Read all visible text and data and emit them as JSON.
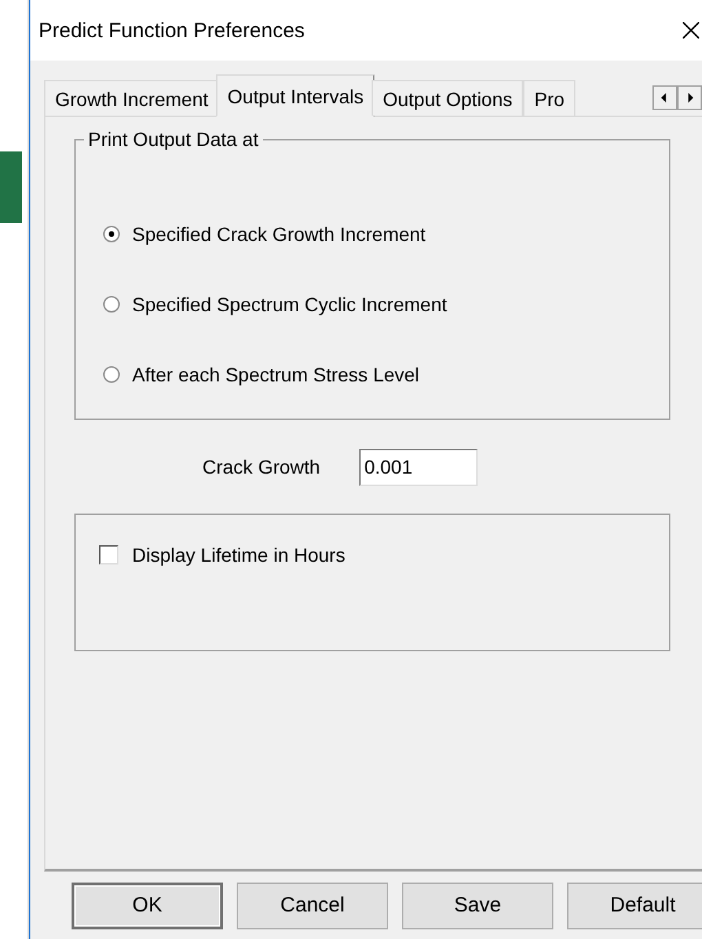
{
  "window": {
    "title": "Predict Function Preferences"
  },
  "tabs": [
    {
      "label": "Growth Increment",
      "selected": false
    },
    {
      "label": "Output Intervals",
      "selected": true
    },
    {
      "label": "Output Options",
      "selected": false
    },
    {
      "label": "Pro",
      "selected": false
    }
  ],
  "print_group": {
    "title": "Print Output Data at",
    "options": [
      {
        "label": "Specified Crack Growth Increment",
        "selected": true
      },
      {
        "label": "Specified Spectrum Cyclic Increment",
        "selected": false
      },
      {
        "label": "After each Spectrum Stress Level",
        "selected": false
      }
    ]
  },
  "crack_growth": {
    "label": "Crack Growth",
    "value": "0.001"
  },
  "lifetime": {
    "label": "Display Lifetime in Hours",
    "checked": false
  },
  "buttons": [
    {
      "label": "OK",
      "default": true
    },
    {
      "label": "Cancel",
      "default": false
    },
    {
      "label": "Save",
      "default": false
    },
    {
      "label": "Default",
      "default": false
    }
  ]
}
